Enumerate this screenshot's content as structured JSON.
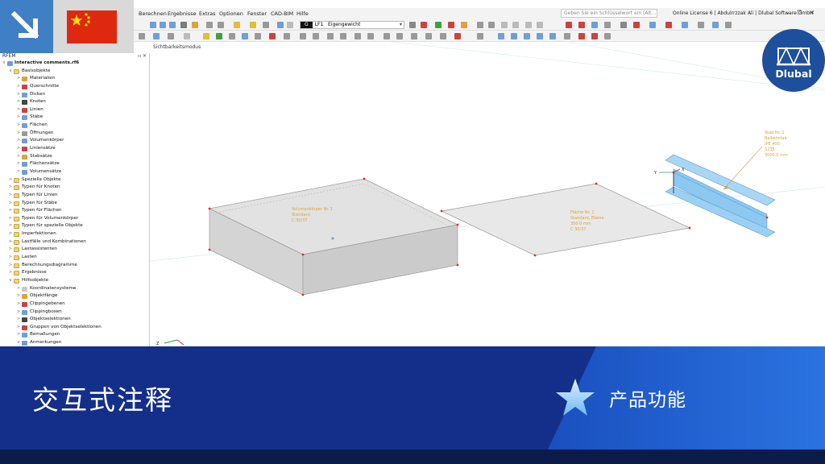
{
  "menu": {
    "items": [
      "Berechnen",
      "Ergebnisse",
      "Extras",
      "Optionen",
      "Fenster",
      "CAD-BIM",
      "Hilfe"
    ],
    "search_placeholder": "Geben Sie ein Schlüsselwort ein (Alt...",
    "license": "Online License 6 | Abdulrrzzak Ali | Dlubal Software GmbH"
  },
  "toolbar": {
    "load_case_tag": "G",
    "load_case_id": "LF1",
    "load_case_name": "Eigengewicht"
  },
  "navigator": {
    "title": "RFEM",
    "file": "Interactive comments.rf6",
    "items": [
      {
        "label": "Basisobjekte",
        "level": 1,
        "expanded": true
      },
      {
        "label": "Materialien",
        "level": 2
      },
      {
        "label": "Querschnitte",
        "level": 2
      },
      {
        "label": "Dicken",
        "level": 2
      },
      {
        "label": "Knoten",
        "level": 2
      },
      {
        "label": "Linien",
        "level": 2
      },
      {
        "label": "Stäbe",
        "level": 2
      },
      {
        "label": "Flächen",
        "level": 2
      },
      {
        "label": "Öffnungen",
        "level": 2
      },
      {
        "label": "Volumenkörper",
        "level": 2
      },
      {
        "label": "Liniensätze",
        "level": 2
      },
      {
        "label": "Stabsätze",
        "level": 2
      },
      {
        "label": "Flächensätze",
        "level": 2
      },
      {
        "label": "Volumensätze",
        "level": 2
      },
      {
        "label": "Spezielle Objekte",
        "level": 1
      },
      {
        "label": "Typen für Knoten",
        "level": 1
      },
      {
        "label": "Typen für Linien",
        "level": 1
      },
      {
        "label": "Typen für Stäbe",
        "level": 1
      },
      {
        "label": "Typen für Flächen",
        "level": 1
      },
      {
        "label": "Typen für Volumenkörper",
        "level": 1
      },
      {
        "label": "Typen für spezielle Objekte",
        "level": 1
      },
      {
        "label": "Imperfektionen",
        "level": 1
      },
      {
        "label": "Lastfälle und Kombinationen",
        "level": 1
      },
      {
        "label": "Lastassistenten",
        "level": 1
      },
      {
        "label": "Lasten",
        "level": 1
      },
      {
        "label": "Berechnungsdiagramme",
        "level": 1
      },
      {
        "label": "Ergebnisse",
        "level": 1
      },
      {
        "label": "Hilfsobjekte",
        "level": 1,
        "expanded": true
      },
      {
        "label": "Koordinatensysteme",
        "level": 2
      },
      {
        "label": "Objektfänge",
        "level": 2
      },
      {
        "label": "Clippingebenen",
        "level": 2
      },
      {
        "label": "Clippingboxen",
        "level": 2
      },
      {
        "label": "Objektselektionen",
        "level": 2
      },
      {
        "label": "Gruppen von Objektselektionen",
        "level": 2
      },
      {
        "label": "Bemaßungen",
        "level": 2
      },
      {
        "label": "Anmerkungen",
        "level": 2,
        "expanded": true
      }
    ]
  },
  "viewport": {
    "mode_label": "Sichtbarkeitsmodus",
    "solid_note": [
      "Volumenkörper Nr. 1",
      "Standard",
      "C 30/37"
    ],
    "surface_note": [
      "Fläche Nr. 1",
      "Standard, Ebene",
      "300.0 mm",
      "C 30/37"
    ],
    "member_note": [
      "Stab Nr. 1",
      "Balkenstab",
      "IPE 400",
      "S235",
      "3000.0 mm"
    ],
    "axis_labels": {
      "x": "X",
      "y": "Y",
      "z": "Z"
    }
  },
  "logo": {
    "text": "Dlubal"
  },
  "banner": {
    "title": "交互式注释",
    "subtitle": "产品功能"
  },
  "colors": {
    "banner": "#142f8a",
    "banner_accent": "#1e5fd0",
    "annotation": "#e0a23a",
    "member": "#8cc8f0",
    "node": "#e03030"
  }
}
